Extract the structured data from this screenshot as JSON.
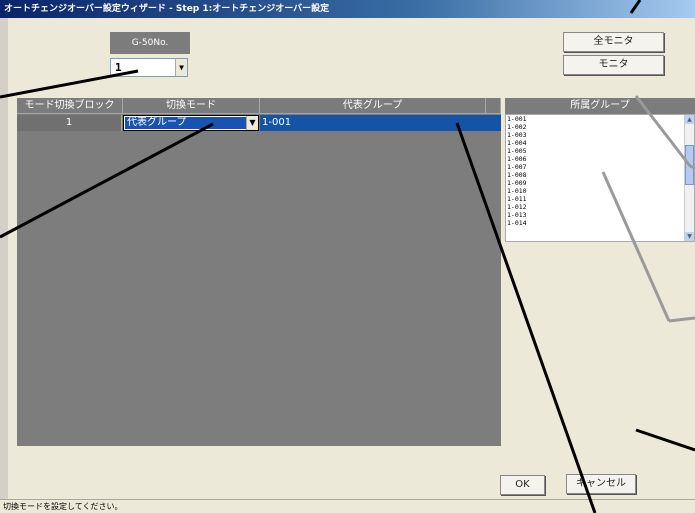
{
  "window": {
    "title": "オートチェンジオーバー設定ウィザード - Step 1:オートチェンジオーバー設定"
  },
  "g50": {
    "label": "G-50No.",
    "value": "1"
  },
  "buttons": {
    "monitor_all": "全モニタ",
    "monitor": "モニタ",
    "ok": "OK",
    "cancel": "キャンセル"
  },
  "grid": {
    "headers": [
      "モード切換ブロック",
      "切換モード",
      "代表グループ"
    ],
    "rows": [
      {
        "block": "1",
        "mode": "代表グループ",
        "rep_group": "1-001"
      }
    ]
  },
  "side": {
    "header": "所属グループ",
    "items": [
      "1-001",
      "1-002",
      "1-003",
      "1-004",
      "1-005",
      "1-006",
      "1-007",
      "1-008",
      "1-009",
      "1-010",
      "1-011",
      "1-012",
      "1-013",
      "1-014"
    ]
  },
  "status": {
    "text": "切換モードを設定してください。"
  }
}
